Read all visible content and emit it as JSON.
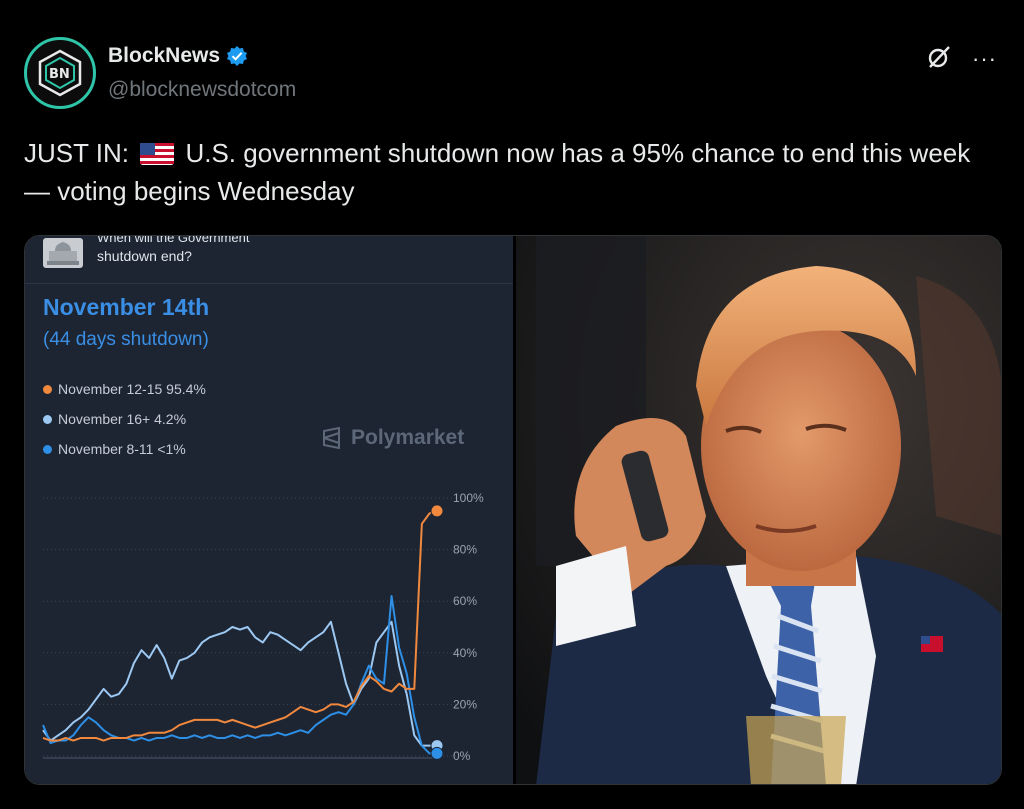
{
  "author": {
    "name": "BlockNews",
    "handle": "@blocknewsdotcom",
    "avatar_text": "BN",
    "verified_color": "#1d9bf0"
  },
  "icons": {
    "grok": "grok-icon",
    "more": "more-icon"
  },
  "tweet": {
    "text_before_flag": "JUST IN:",
    "text_after_flag": "U.S. government shutdown now has a 95% chance to end this week — voting begins Wednesday"
  },
  "market": {
    "question_top": "When will the Government",
    "question": "shutdown end?",
    "outcome": "November 14th",
    "outcome_sub": "(44 days shutdown)",
    "legend": [
      {
        "label": "November 12-15 95.4%",
        "color": "#f0883e"
      },
      {
        "label": "November 16+ 4.2%",
        "color": "#9cc8f2"
      },
      {
        "label": "November 8-11 <1%",
        "color": "#2d8fe6"
      }
    ],
    "watermark": "Polymarket"
  },
  "chart_data": {
    "type": "line",
    "yticks": [
      "100%",
      "80%",
      "60%",
      "40%",
      "20%",
      "0%"
    ],
    "ylim": [
      0,
      100
    ],
    "series": [
      {
        "name": "November 12-15",
        "color": "#f0883e",
        "values": [
          7,
          6,
          6,
          7,
          6,
          7,
          7,
          7,
          6,
          7,
          7,
          7,
          8,
          8,
          9,
          9,
          9,
          10,
          12,
          13,
          14,
          14,
          14,
          14,
          13,
          14,
          13,
          12,
          11,
          12,
          13,
          14,
          15,
          17,
          19,
          18,
          17,
          18,
          20,
          20,
          19,
          21,
          27,
          31,
          29,
          26,
          25,
          28,
          26,
          26,
          90,
          94,
          95
        ]
      },
      {
        "name": "November 16+",
        "color": "#9cc8f2",
        "values": [
          10,
          6,
          8,
          10,
          13,
          15,
          18,
          22,
          26,
          23,
          24,
          28,
          36,
          41,
          38,
          43,
          38,
          30,
          37,
          38,
          40,
          44,
          46,
          47,
          48,
          50,
          49,
          50,
          46,
          44,
          48,
          47,
          45,
          43,
          41,
          44,
          46,
          48,
          52,
          40,
          28,
          20,
          26,
          30,
          44,
          48,
          52,
          35,
          24,
          8,
          4,
          4,
          4
        ]
      },
      {
        "name": "November 8-11",
        "color": "#2d8fe6",
        "values": [
          12,
          5,
          6,
          6,
          8,
          12,
          15,
          13,
          10,
          8,
          7,
          7,
          6,
          7,
          6,
          7,
          7,
          8,
          7,
          7,
          8,
          7,
          8,
          7,
          7,
          8,
          7,
          8,
          7,
          8,
          8,
          9,
          8,
          9,
          10,
          9,
          12,
          14,
          16,
          17,
          16,
          20,
          28,
          35,
          30,
          28,
          62,
          42,
          32,
          15,
          4,
          1,
          1
        ]
      }
    ]
  }
}
